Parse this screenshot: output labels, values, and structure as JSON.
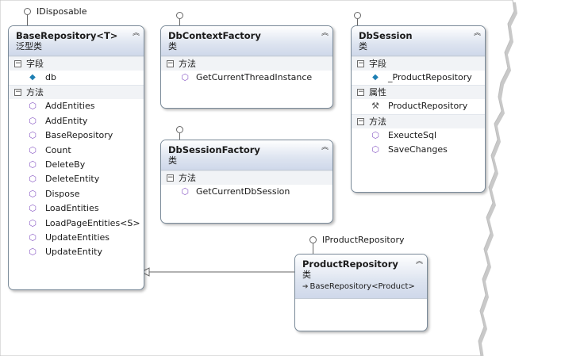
{
  "classes": {
    "base_repository": {
      "name": "BaseRepository<T>",
      "stereotype": "泛型类",
      "interface": "IDisposable",
      "sections": [
        {
          "label": "字段",
          "members": [
            {
              "name": "db",
              "icon": "field-icon"
            }
          ]
        },
        {
          "label": "方法",
          "members": [
            {
              "name": "AddEntities",
              "icon": "method-icon"
            },
            {
              "name": "AddEntity",
              "icon": "method-icon"
            },
            {
              "name": "BaseRepository",
              "icon": "method-icon"
            },
            {
              "name": "Count",
              "icon": "method-icon"
            },
            {
              "name": "DeleteBy",
              "icon": "method-icon"
            },
            {
              "name": "DeleteEntity",
              "icon": "method-icon"
            },
            {
              "name": "Dispose",
              "icon": "method-icon"
            },
            {
              "name": "LoadEntities",
              "icon": "method-icon"
            },
            {
              "name": "LoadPageEntities<S>",
              "icon": "method-icon"
            },
            {
              "name": "UpdateEntities",
              "icon": "method-icon"
            },
            {
              "name": "UpdateEntity",
              "icon": "method-icon"
            }
          ]
        }
      ]
    },
    "db_context_factory": {
      "name": "DbContextFactory",
      "stereotype": "类",
      "sections": [
        {
          "label": "方法",
          "members": [
            {
              "name": "GetCurrentThreadInstance",
              "icon": "method-icon"
            }
          ]
        }
      ]
    },
    "db_session_factory": {
      "name": "DbSessionFactory",
      "stereotype": "类",
      "sections": [
        {
          "label": "方法",
          "members": [
            {
              "name": "GetCurrentDbSession",
              "icon": "method-icon"
            }
          ]
        }
      ]
    },
    "db_session": {
      "name": "DbSession",
      "stereotype": "类",
      "sections": [
        {
          "label": "字段",
          "members": [
            {
              "name": "_ProductRepository",
              "icon": "field-icon"
            }
          ]
        },
        {
          "label": "属性",
          "members": [
            {
              "name": "ProductRepository",
              "icon": "property-icon"
            }
          ]
        },
        {
          "label": "方法",
          "members": [
            {
              "name": "ExeucteSql",
              "icon": "method-icon"
            },
            {
              "name": "SaveChanges",
              "icon": "method-icon"
            }
          ]
        }
      ]
    },
    "product_repository": {
      "name": "ProductRepository",
      "stereotype": "类",
      "interface": "IProductRepository",
      "base_type": "BaseRepository<Product>"
    }
  },
  "icons": {
    "collapse": "double-chevron-up-icon",
    "expander": "minus-box-icon"
  },
  "colors": {
    "header_top": "#ffffff",
    "header_bottom": "#cfd8ea",
    "border": "#7a8a99",
    "method": "#8d5fc7",
    "field": "#1e7fb3"
  }
}
